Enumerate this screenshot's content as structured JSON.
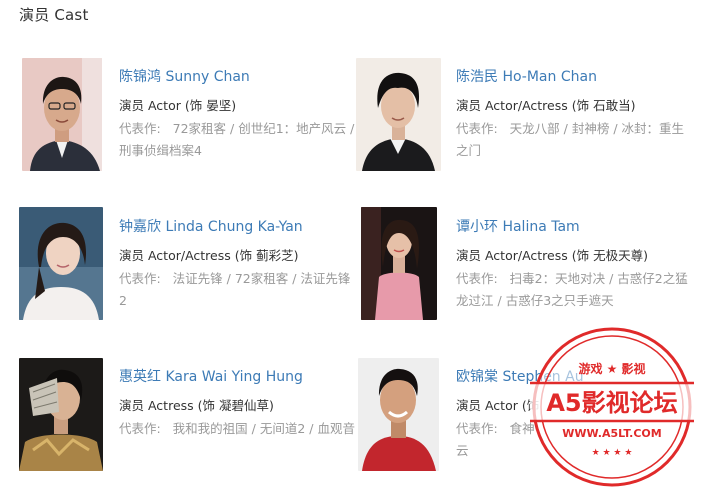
{
  "section": {
    "title": "演员 Cast"
  },
  "cast": [
    {
      "name": "陈锦鸿 Sunny Chan",
      "role": "演员 Actor (饰 晏坚)",
      "works_label": "代表作:",
      "works": [
        "72家租客",
        "创世纪1：地产风云",
        "刑事侦缉档案4"
      ],
      "photo_colors": {
        "bg": "#e8c9c4",
        "skin": "#d7a98c",
        "hair": "#1c1614",
        "cloth": "#2b2f3a"
      }
    },
    {
      "name": "陈浩民 Ho-Man Chan",
      "role": "演员 Actor/Actress (饰 石敢当)",
      "works_label": "代表作:",
      "works": [
        "天龙八部",
        "封神榜",
        "冰封：重生之门"
      ],
      "photo_colors": {
        "bg": "#f2ece6",
        "skin": "#e4bfa6",
        "hair": "#121010",
        "cloth": "#1b1b1d"
      }
    },
    {
      "name": "钟嘉欣 Linda Chung Ka-Yan",
      "role": "演员 Actor/Actress (饰 蓟彩芝)",
      "works_label": "代表作:",
      "works": [
        "法证先锋",
        "72家租客",
        "法证先锋2"
      ],
      "photo_colors": {
        "bg": "#3a5b76",
        "skin": "#efd3c2",
        "hair": "#241a16",
        "cloth": "#f3f0ee"
      }
    },
    {
      "name": "谭小环 Halina Tam",
      "role": "演员 Actor/Actress (饰 无极天尊)",
      "works_label": "代表作:",
      "works": [
        "扫毒2：天地对决",
        "古惑仔2之猛龙过江",
        "古惑仔3之只手遮天"
      ],
      "photo_colors": {
        "bg": "#1a1414",
        "skin": "#e6c0a8",
        "hair": "#2a1a14",
        "cloth": "#e79aaa"
      }
    },
    {
      "name": "惠英红 Kara Wai Ying Hung",
      "role": "演员 Actress (饰 凝碧仙草)",
      "works_label": "代表作:",
      "works": [
        "我和我的祖国",
        "无间道2",
        "血观音"
      ],
      "photo_colors": {
        "bg": "#1c1a18",
        "skin": "#d9b294",
        "hair": "#0f0d0c",
        "cloth": "#a98447"
      }
    },
    {
      "name": "欧锦棠 Stephen Au",
      "role": "演员 Actor (饰 ",
      "works_label": "代表作:",
      "works": [
        "食神",
        "云"
      ],
      "photo_colors": {
        "bg": "#eeeeee",
        "skin": "#d4a07e",
        "hair": "#141010",
        "cloth": "#c2262d"
      }
    }
  ],
  "watermark": {
    "top_text": "游戏 ★ 影视",
    "main_text": "A5影视论坛",
    "url": "WWW.A5LT.COM",
    "color": "#e02a2a"
  }
}
